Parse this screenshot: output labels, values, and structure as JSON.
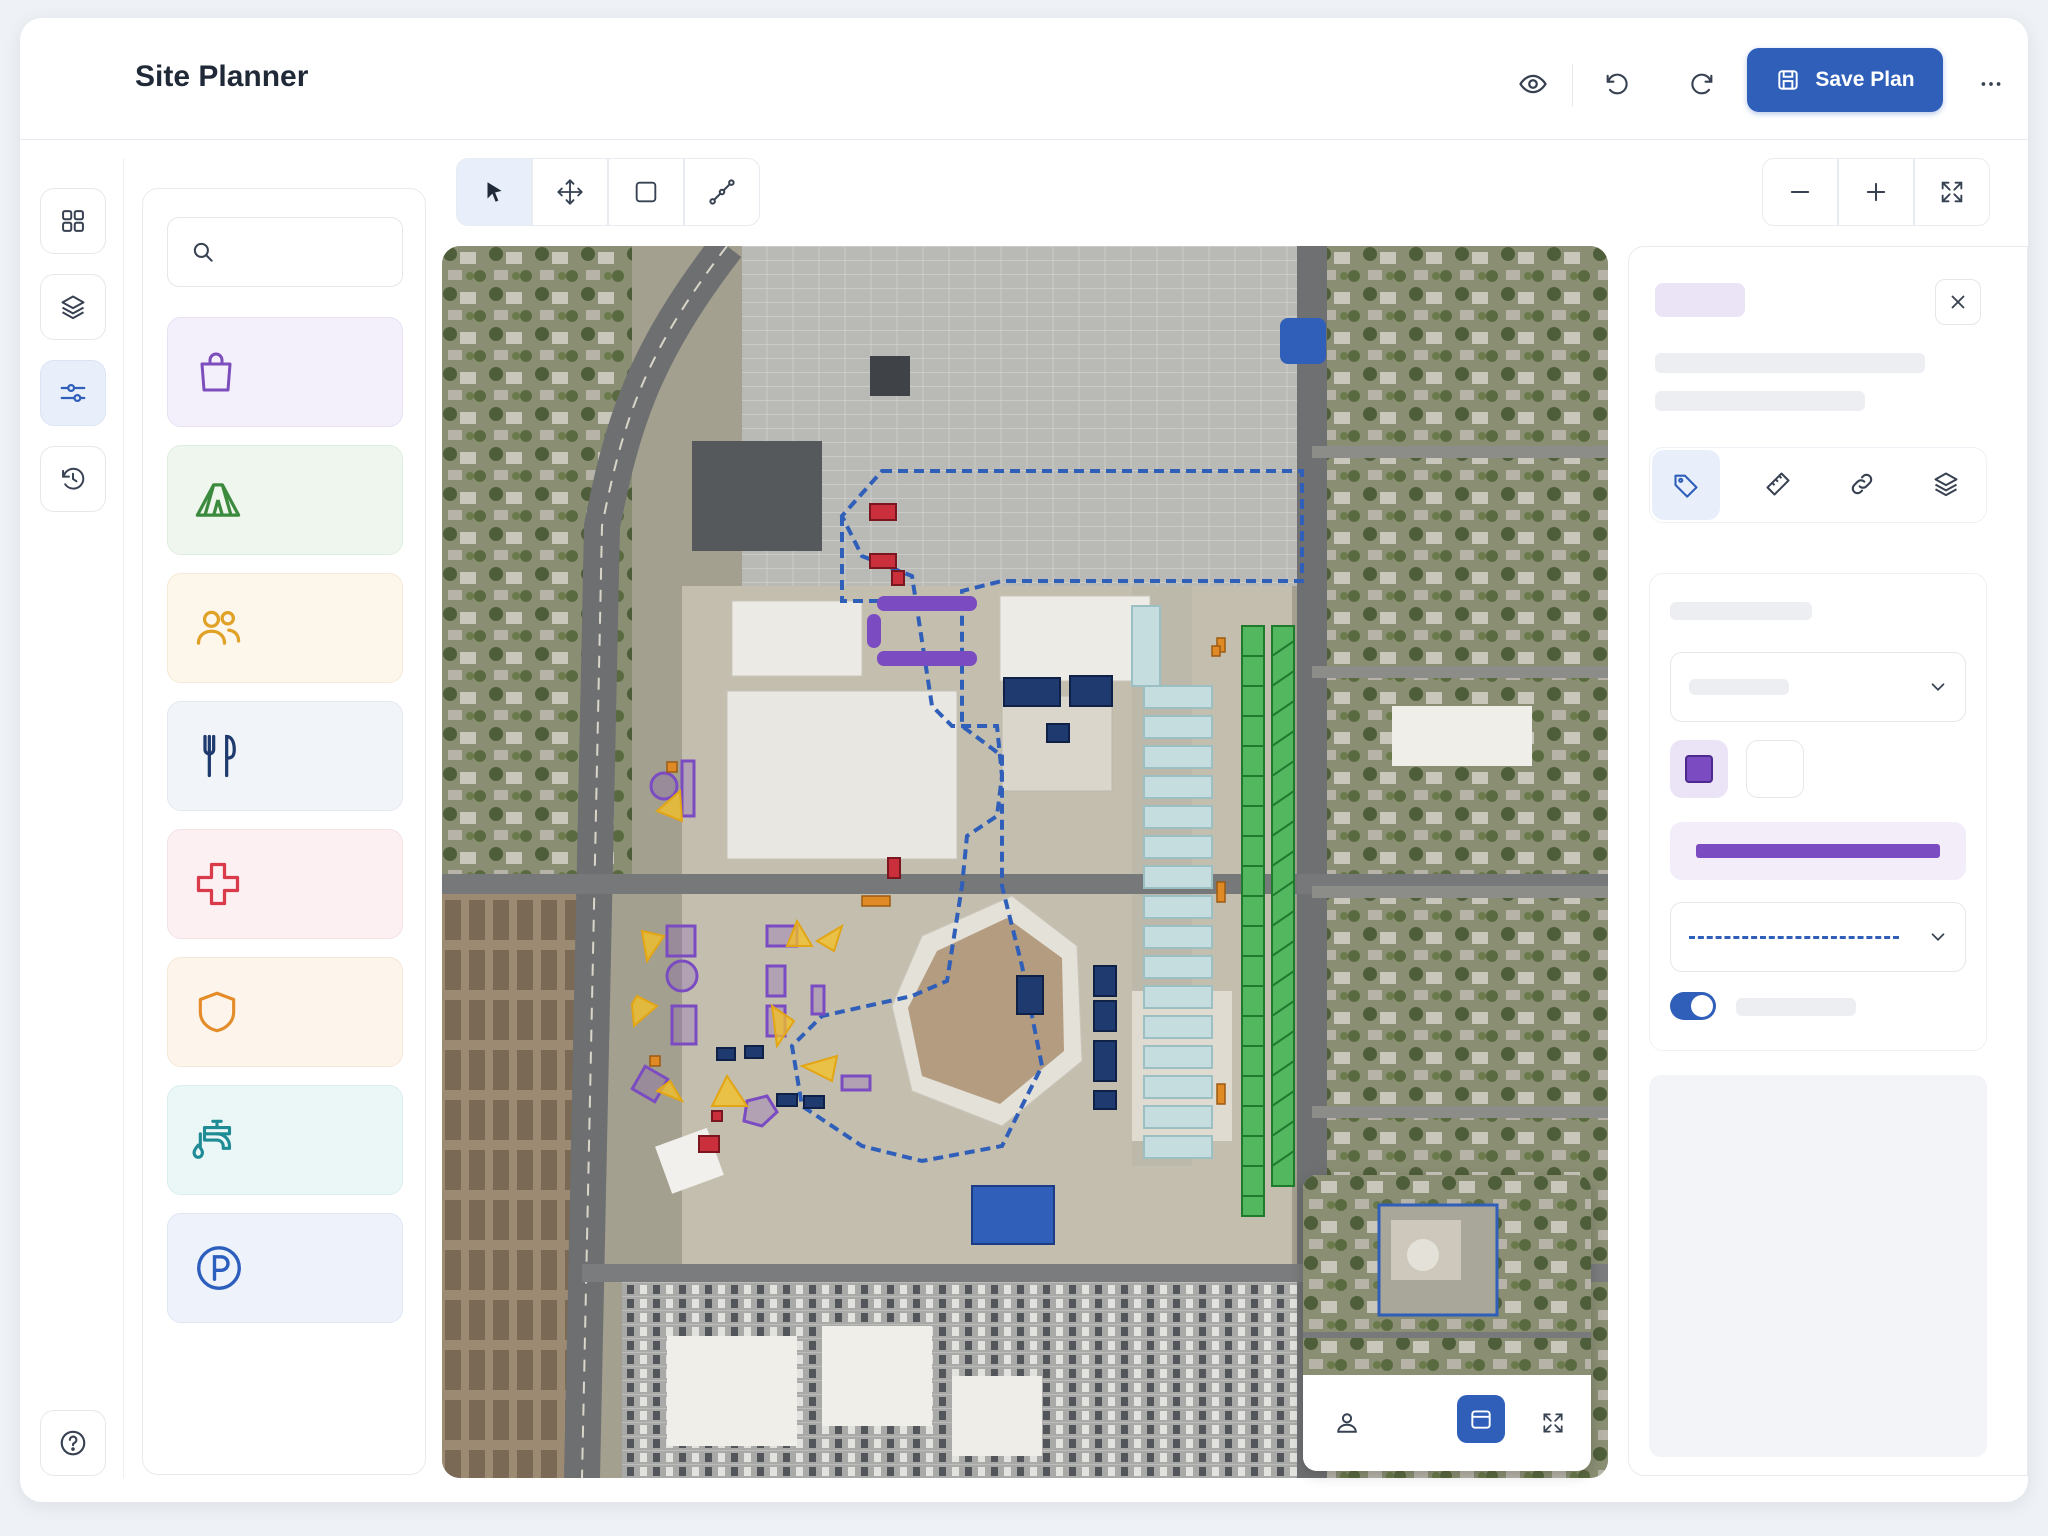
{
  "app": {
    "title": "Site Planner"
  },
  "header": {
    "save_label": "Save Plan",
    "icons": [
      "eye-icon",
      "undo-icon",
      "redo-icon",
      "save-icon",
      "more-icon"
    ]
  },
  "rail": {
    "items": [
      "grid-icon",
      "layers-icon",
      "sliders-icon",
      "history-icon"
    ],
    "bottom": "help-icon"
  },
  "palette": {
    "search_placeholder": "",
    "categories": [
      {
        "icon": "shopping-bag-icon",
        "color": "#7c4dbd",
        "bg": "#f4f0fb"
      },
      {
        "icon": "tent-icon",
        "color": "#3b8a3e",
        "bg": "#eef6ee"
      },
      {
        "icon": "people-icon",
        "color": "#e0a127",
        "bg": "#fdf6ea"
      },
      {
        "icon": "fork-knife-icon",
        "color": "#1e3a6e",
        "bg": "#f1f4f9"
      },
      {
        "icon": "medical-cross-icon",
        "color": "#d93b4b",
        "bg": "#fcf0f2"
      },
      {
        "icon": "shield-icon",
        "color": "#e58c2a",
        "bg": "#fdf4eb"
      },
      {
        "icon": "water-tap-icon",
        "color": "#1f8b95",
        "bg": "#ebf6f7"
      },
      {
        "icon": "parking-icon",
        "color": "#2c5ebd",
        "bg": "#eef3fb"
      }
    ]
  },
  "toolbar": {
    "tools": [
      "select-arrow-icon",
      "move-icon",
      "rectangle-icon",
      "path-icon"
    ],
    "zoom": [
      "zoom-out-icon",
      "zoom-in-icon",
      "fullscreen-icon"
    ]
  },
  "minimap": {
    "icons": [
      "user-view-icon",
      "calendar-icon",
      "expand-icon"
    ]
  },
  "props": {
    "tabs": [
      "tag-icon",
      "ruler-icon",
      "link-icon",
      "layers-icon"
    ],
    "fill_color": "#7b4cc1",
    "stroke_color": "#7b4cc1",
    "toggle_on": true
  }
}
